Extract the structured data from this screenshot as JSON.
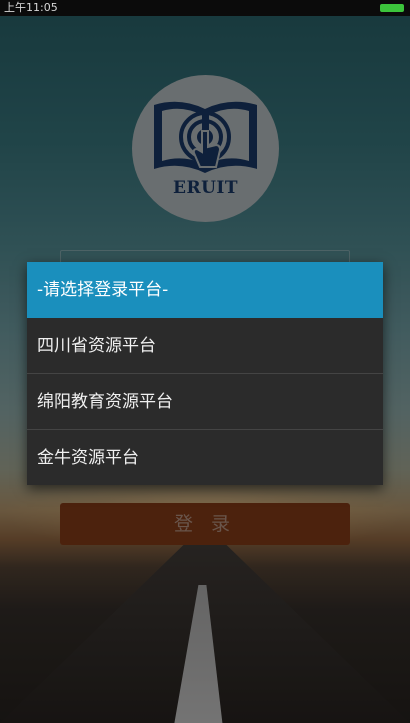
{
  "status_bar": {
    "time": "上午11:05"
  },
  "logo": {
    "text": "ERUIT"
  },
  "dropdown": {
    "options": [
      "-请选择登录平台-",
      "四川省资源平台",
      "绵阳教育资源平台",
      "金牛资源平台"
    ],
    "selected_index": 0
  },
  "login_button": {
    "label": "登 录"
  },
  "colors": {
    "selected_bg": "#1a8fbd",
    "dropdown_bg": "#2b2b2b",
    "login_bg": "#93411a",
    "logo_blue": "#1c3f72"
  }
}
